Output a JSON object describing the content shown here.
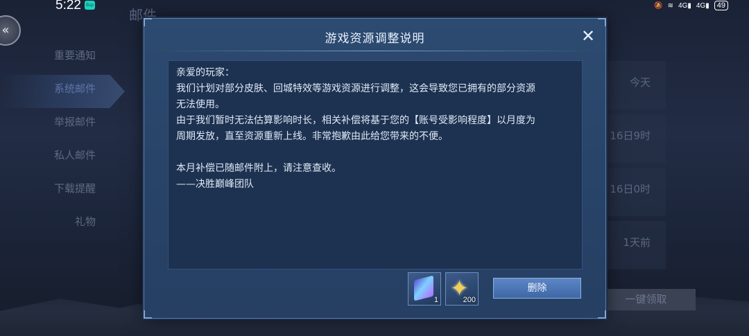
{
  "status_bar": {
    "time": "5:22",
    "app_badge": "Bsp",
    "network_1": "4G",
    "network_2": "4G",
    "battery": "49"
  },
  "background": {
    "page_title": "邮件",
    "side_nav": [
      {
        "label": "重要通知",
        "active": false
      },
      {
        "label": "系统邮件",
        "active": true
      },
      {
        "label": "举报邮件",
        "active": false
      },
      {
        "label": "私人邮件",
        "active": false
      },
      {
        "label": "下载提醒",
        "active": false
      },
      {
        "label": "礼物",
        "active": false
      }
    ],
    "mail_times": [
      "今天",
      "16日9时",
      "16日0时",
      "1天前"
    ],
    "claim_all_label": "一键领取"
  },
  "dialog": {
    "title": "游戏资源调整说明",
    "body_lines": [
      "亲爱的玩家：",
      "我们计划对部分皮肤、回城特效等游戏资源进行调整，这会导致您已拥有的部分资源",
      "无法使用。",
      "由于我们暂时无法估算影响时长，相关补偿将基于您的【账号受影响程度】以月度为",
      "周期发放，直至资源重新上线。非常抱歉由此给您带来的不便。",
      "",
      "本月补偿已随邮件附上，请注意查收。",
      "——决胜巅峰团队"
    ],
    "attachments": [
      {
        "icon": "skin-voucher-icon",
        "count": "1"
      },
      {
        "icon": "star-crystal-icon",
        "count": "200"
      }
    ],
    "delete_label": "删除"
  }
}
